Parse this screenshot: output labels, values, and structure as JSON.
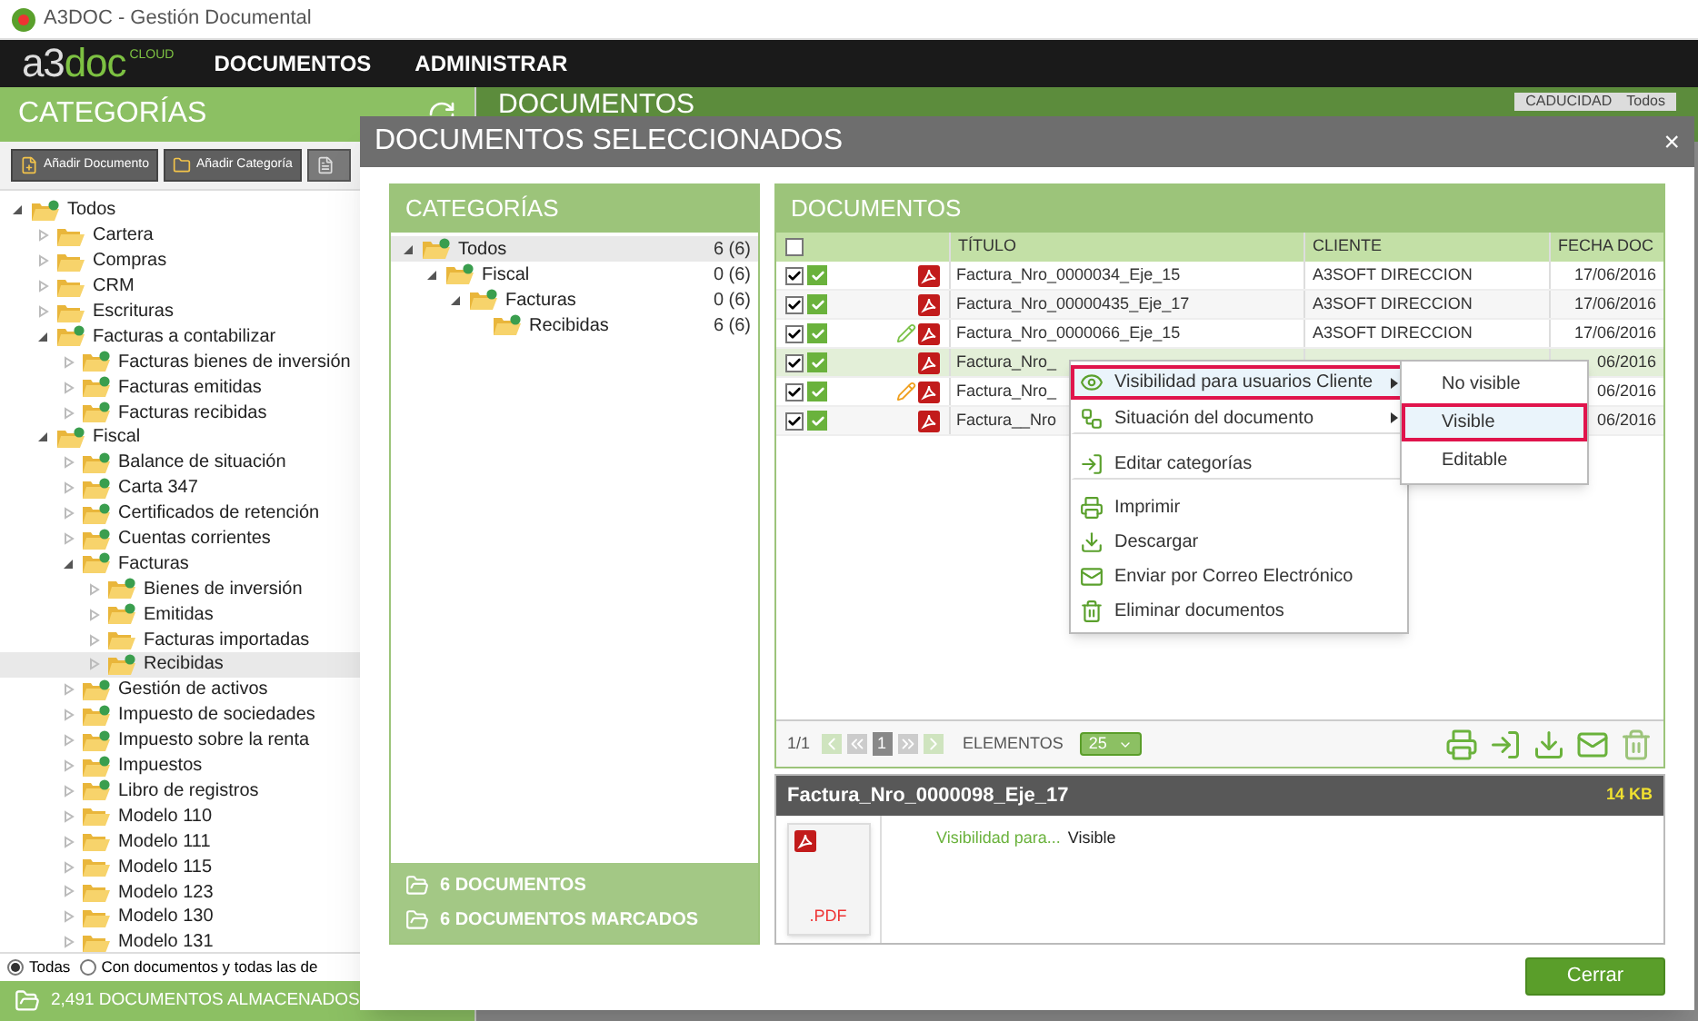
{
  "window": {
    "title": "A3DOC - Gestión Documental"
  },
  "nav": {
    "logo_parts": [
      "a3",
      "doc"
    ],
    "logo_tag": "CLOUD",
    "items": [
      "DOCUMENTOS",
      "ADMINISTRAR"
    ]
  },
  "sidebar": {
    "title": "CATEGORÍAS",
    "buttons": [
      "Añadir Documento",
      "Añadir Categoría"
    ],
    "tree": [
      {
        "label": "Todos",
        "expanded": true,
        "badge": true,
        "selected": false,
        "children": [
          {
            "label": "Cartera",
            "expanded": false,
            "badge": false,
            "selected": false
          },
          {
            "label": "Compras",
            "expanded": false,
            "badge": false,
            "selected": false
          },
          {
            "label": "CRM",
            "expanded": false,
            "badge": false,
            "selected": false
          },
          {
            "label": "Escrituras",
            "expanded": false,
            "badge": false,
            "selected": false
          },
          {
            "label": "Facturas a contabilizar",
            "expanded": true,
            "badge": true,
            "selected": false,
            "children": [
              {
                "label": "Facturas bienes de inversión",
                "expanded": false,
                "badge": true,
                "selected": false
              },
              {
                "label": "Facturas emitidas",
                "expanded": false,
                "badge": true,
                "selected": false
              },
              {
                "label": "Facturas recibidas",
                "expanded": false,
                "badge": true,
                "selected": false
              }
            ]
          },
          {
            "label": "Fiscal",
            "expanded": true,
            "badge": true,
            "selected": false,
            "children": [
              {
                "label": "Balance de situación",
                "expanded": false,
                "badge": true,
                "selected": false
              },
              {
                "label": "Carta 347",
                "expanded": false,
                "badge": true,
                "selected": false
              },
              {
                "label": "Certificados de retención",
                "expanded": false,
                "badge": true,
                "selected": false
              },
              {
                "label": "Cuentas corrientes",
                "expanded": false,
                "badge": true,
                "selected": false
              },
              {
                "label": "Facturas",
                "expanded": true,
                "badge": true,
                "selected": false,
                "children": [
                  {
                    "label": "Bienes de inversión",
                    "expanded": false,
                    "badge": true,
                    "selected": false
                  },
                  {
                    "label": "Emitidas",
                    "expanded": false,
                    "badge": true,
                    "selected": false
                  },
                  {
                    "label": "Facturas importadas",
                    "expanded": false,
                    "badge": false,
                    "selected": false
                  },
                  {
                    "label": "Recibidas",
                    "expanded": false,
                    "badge": true,
                    "selected": true
                  }
                ]
              },
              {
                "label": "Gestión de activos",
                "expanded": false,
                "badge": true,
                "selected": false
              },
              {
                "label": "Impuesto de sociedades",
                "expanded": false,
                "badge": true,
                "selected": false
              },
              {
                "label": "Impuesto sobre la renta",
                "expanded": false,
                "badge": true,
                "selected": false
              },
              {
                "label": "Impuestos",
                "expanded": false,
                "badge": true,
                "selected": false
              },
              {
                "label": "Libro de registros",
                "expanded": false,
                "badge": true,
                "selected": false
              },
              {
                "label": "Modelo 110",
                "expanded": false,
                "badge": false,
                "selected": false
              },
              {
                "label": "Modelo 111",
                "expanded": false,
                "badge": false,
                "selected": false
              },
              {
                "label": "Modelo 115",
                "expanded": false,
                "badge": false,
                "selected": false
              },
              {
                "label": "Modelo 123",
                "expanded": false,
                "badge": false,
                "selected": false
              },
              {
                "label": "Modelo 130",
                "expanded": false,
                "badge": false,
                "selected": false
              },
              {
                "label": "Modelo 131",
                "expanded": false,
                "badge": false,
                "selected": false
              }
            ]
          }
        ]
      }
    ],
    "filter": [
      {
        "label": "Todas",
        "selected": true
      },
      {
        "label": "Con documentos y todas las de",
        "selected": false
      }
    ],
    "footer": "2,491 DOCUMENTOS ALMACENADOS"
  },
  "main": {
    "title": "DOCUMENTOS",
    "filter_label": "CADUCIDAD",
    "filter_value": "Todos"
  },
  "dialog": {
    "title": "DOCUMENTOS SELECCIONADOS",
    "close": "×",
    "categories": {
      "title": "CATEGORÍAS",
      "tree": [
        {
          "label": "Todos",
          "count": "6 (6)",
          "expanded": true,
          "badge": true,
          "selected": true,
          "children": [
            {
              "label": "Fiscal",
              "count": "0 (6)",
              "expanded": true,
              "badge": true,
              "selected": false,
              "children": [
                {
                  "label": "Facturas",
                  "count": "0 (6)",
                  "expanded": true,
                  "badge": true,
                  "selected": false,
                  "children": [
                    {
                      "label": "Recibidas",
                      "count": "6 (6)",
                      "badge": true,
                      "selected": false
                    }
                  ]
                }
              ]
            }
          ]
        }
      ],
      "summary": [
        "6 DOCUMENTOS",
        "6 DOCUMENTOS MARCADOS"
      ]
    },
    "documents": {
      "title": "DOCUMENTOS",
      "select_all_checked": false,
      "columns": [
        "TÍTULO",
        "CLIENTE",
        "FECHA DOC"
      ],
      "rows": [
        {
          "checked": true,
          "approved": true,
          "title": "Factura_Nro_0000034_Eje_15",
          "client": "A3SOFT DIRECCION",
          "date": "17/06/2016",
          "selected": false
        },
        {
          "checked": true,
          "approved": true,
          "title": "Factura_Nro_00000435_Eje_17",
          "client": "A3SOFT DIRECCION",
          "date": "17/06/2016",
          "selected": false
        },
        {
          "checked": true,
          "approved": true,
          "color": "#7cc24a",
          "title": "Factura_Nro_0000066_Eje_15",
          "client": "A3SOFT DIRECCION",
          "date": "17/06/2016",
          "selected": false
        },
        {
          "checked": true,
          "approved": true,
          "title": "Factura_Nro_",
          "date": "06/2016",
          "selected": true
        },
        {
          "checked": true,
          "approved": true,
          "color": "#f0a020",
          "title": "Factura_Nro_",
          "date": "06/2016",
          "selected": false
        },
        {
          "checked": true,
          "approved": true,
          "title": "Factura__Nro",
          "date": "06/2016",
          "selected": false
        }
      ],
      "pager": {
        "text": "1/1",
        "page": "1",
        "label": "ELEMENTOS",
        "page_size": "25"
      }
    },
    "context_menu": [
      {
        "label": "Visibilidad para usuarios Cliente",
        "submenu": true,
        "selected": true,
        "separator_after": false
      },
      {
        "label": "Situación del documento",
        "submenu": true,
        "selected": false,
        "separator_after": true
      },
      {
        "label": "Editar categorías",
        "submenu": false,
        "selected": false,
        "separator_after": true
      },
      {
        "label": "Imprimir",
        "submenu": false,
        "selected": false,
        "separator_after": false
      },
      {
        "label": "Descargar",
        "submenu": false,
        "selected": false,
        "separator_after": false
      },
      {
        "label": "Enviar por Correo Electrónico",
        "submenu": false,
        "selected": false,
        "separator_after": false
      },
      {
        "label": "Eliminar documentos",
        "submenu": false,
        "selected": false,
        "separator_after": false
      }
    ],
    "submenu": [
      {
        "label": "No visible",
        "selected": false
      },
      {
        "label": "Visible",
        "selected": true
      },
      {
        "label": "Editable",
        "selected": false
      }
    ],
    "detail": {
      "title": "Factura_Nro_0000098_Eje_17",
      "size": "14 KB",
      "thumb_label": ".PDF",
      "fields": [
        {
          "label": "Visibilidad para...",
          "value": "Visible"
        }
      ]
    },
    "close_button": "Cerrar"
  }
}
